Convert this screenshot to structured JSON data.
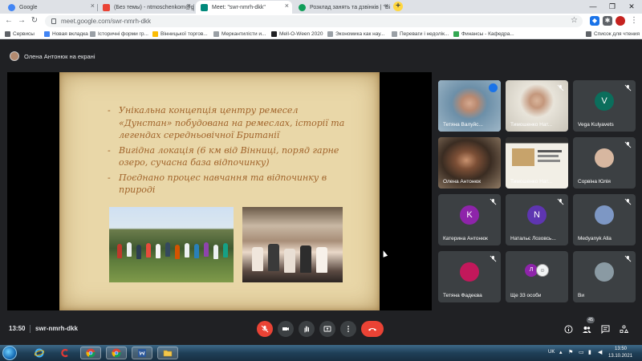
{
  "browser": {
    "tabs": [
      {
        "label": "Google",
        "favicon_color": "#4285f4",
        "active": false
      },
      {
        "label": "(Без темы) - ntmoschenkom@g",
        "favicon_color": "#ea4335",
        "active": false
      },
      {
        "label": "Meet: \"swr-nmrh-dkk\"",
        "favicon_color": "#00897b",
        "active": true
      },
      {
        "label": "Розклад занять та дзвінків | \"Ві",
        "favicon_color": "#0f9d58",
        "active": false
      }
    ],
    "new_tab_label": "+",
    "url": "meet.google.com/swr-nmrh-dkk",
    "bookmarks": [
      {
        "label": "Сервисы",
        "color": "#5f6368"
      },
      {
        "label": "Новая вкладка",
        "color": "#4285f4"
      },
      {
        "label": "Історичні форми гр...",
        "color": "#9aa0a6"
      },
      {
        "label": "Вінницької торгов...",
        "color": "#fbbc04"
      },
      {
        "label": "Меркантилісти и...",
        "color": "#9aa0a6"
      },
      {
        "label": "Mell-O-Ween 2020",
        "color": "#202124"
      },
      {
        "label": "Экономика как нау...",
        "color": "#9aa0a6"
      },
      {
        "label": "Переваги і недолік...",
        "color": "#9aa0a6"
      },
      {
        "label": "Финансы - Кафедра...",
        "color": "#34a853"
      }
    ],
    "reading_list": "Список для чтения"
  },
  "meet": {
    "presenter_label": "Олена Антонюк на екрані",
    "slide_bullets": [
      "Унікальна концепція  центру ремесел «Дунстан» побудована на ремеслах, історії та легендах  середньовічної Британії",
      "Вигідна локація (6 км від Вінниці, поряд гарне озеро,  сучасна база відпочинку)",
      "Поєднано процес навчання та відпочинку в природі"
    ],
    "bullet_marker": "-",
    "participants": [
      {
        "name": "Тетяна Валуйс...",
        "type": "video",
        "speaking": true
      },
      {
        "name": "Тимошенко Нат...",
        "type": "video",
        "speaking": false
      },
      {
        "name": "Vega Kulyavets",
        "type": "initial",
        "initial": "V",
        "color": "#0b6e5c"
      },
      {
        "name": "Олена Антонюк",
        "type": "video",
        "speaking": false
      },
      {
        "name": "Тимошенко Нат...",
        "type": "screen",
        "speaking": false
      },
      {
        "name": "Сорвіна Юлія",
        "type": "photo",
        "color": "#d7b7a0"
      },
      {
        "name": "Катерина Антонюк",
        "type": "initial",
        "initial": "K",
        "color": "#8e24aa"
      },
      {
        "name": "Натальє Лозовсь...",
        "type": "initial",
        "initial": "N",
        "color": "#5e35b1"
      },
      {
        "name": "Medyanyk Alla",
        "type": "photo",
        "color": "#7d97c4"
      },
      {
        "name": "Тетяна Фадеєва",
        "type": "photo",
        "color": "#c2185b"
      },
      {
        "name": "Ще 33 особи",
        "type": "more",
        "initial": "Л",
        "color": "#8e24aa"
      },
      {
        "name": "Ви",
        "type": "photo",
        "color": "#8a9aa3"
      }
    ],
    "clock": "13:50",
    "meeting_code": "swr-nmrh-dkk",
    "participant_count": "45"
  },
  "taskbar": {
    "lang": "UK",
    "time": "13:50",
    "date": "13.10.2021"
  }
}
